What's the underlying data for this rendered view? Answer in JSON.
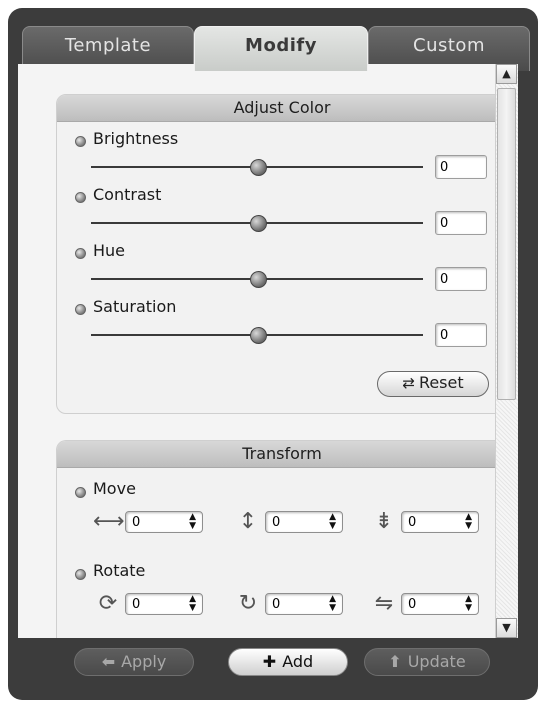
{
  "tabs": [
    {
      "label": "Template",
      "active": false
    },
    {
      "label": "Modify",
      "active": true
    },
    {
      "label": "Custom",
      "active": false
    }
  ],
  "adjust_color": {
    "title": "Adjust Color",
    "rows": [
      {
        "label": "Brightness",
        "value": "0",
        "level": 0.5
      },
      {
        "label": "Contrast",
        "value": "0",
        "level": 0.5
      },
      {
        "label": "Hue",
        "value": "0",
        "level": 0.5
      },
      {
        "label": "Saturation",
        "value": "0",
        "level": 0.5
      }
    ],
    "reset_label": "Reset",
    "reset_icon": "rotate-arrows-icon"
  },
  "transform": {
    "title": "Transform",
    "move": {
      "label": "Move",
      "fields": [
        {
          "icon": "horizontal-arrows-icon",
          "value": "0"
        },
        {
          "icon": "vertical-arrows-icon",
          "value": "0"
        },
        {
          "icon": "depth-arrows-icon",
          "value": "0"
        }
      ]
    },
    "rotate": {
      "label": "Rotate",
      "fields": [
        {
          "icon": "rotate-x-icon",
          "value": "0"
        },
        {
          "icon": "rotate-y-icon",
          "value": "0"
        },
        {
          "icon": "rotate-z-icon",
          "value": "0"
        }
      ]
    }
  },
  "footer": {
    "apply": {
      "label": "Apply",
      "icon": "left-arrow-icon",
      "enabled": false
    },
    "add": {
      "label": "Add",
      "icon": "plus-icon",
      "enabled": true
    },
    "update": {
      "label": "Update",
      "icon": "up-arrow-icon",
      "enabled": false
    }
  },
  "colors": {
    "frame": "#3c3c3c",
    "content": "#f4f4f4",
    "active_tab": "#d8dad8",
    "panel_header": "#c8c8c8"
  }
}
